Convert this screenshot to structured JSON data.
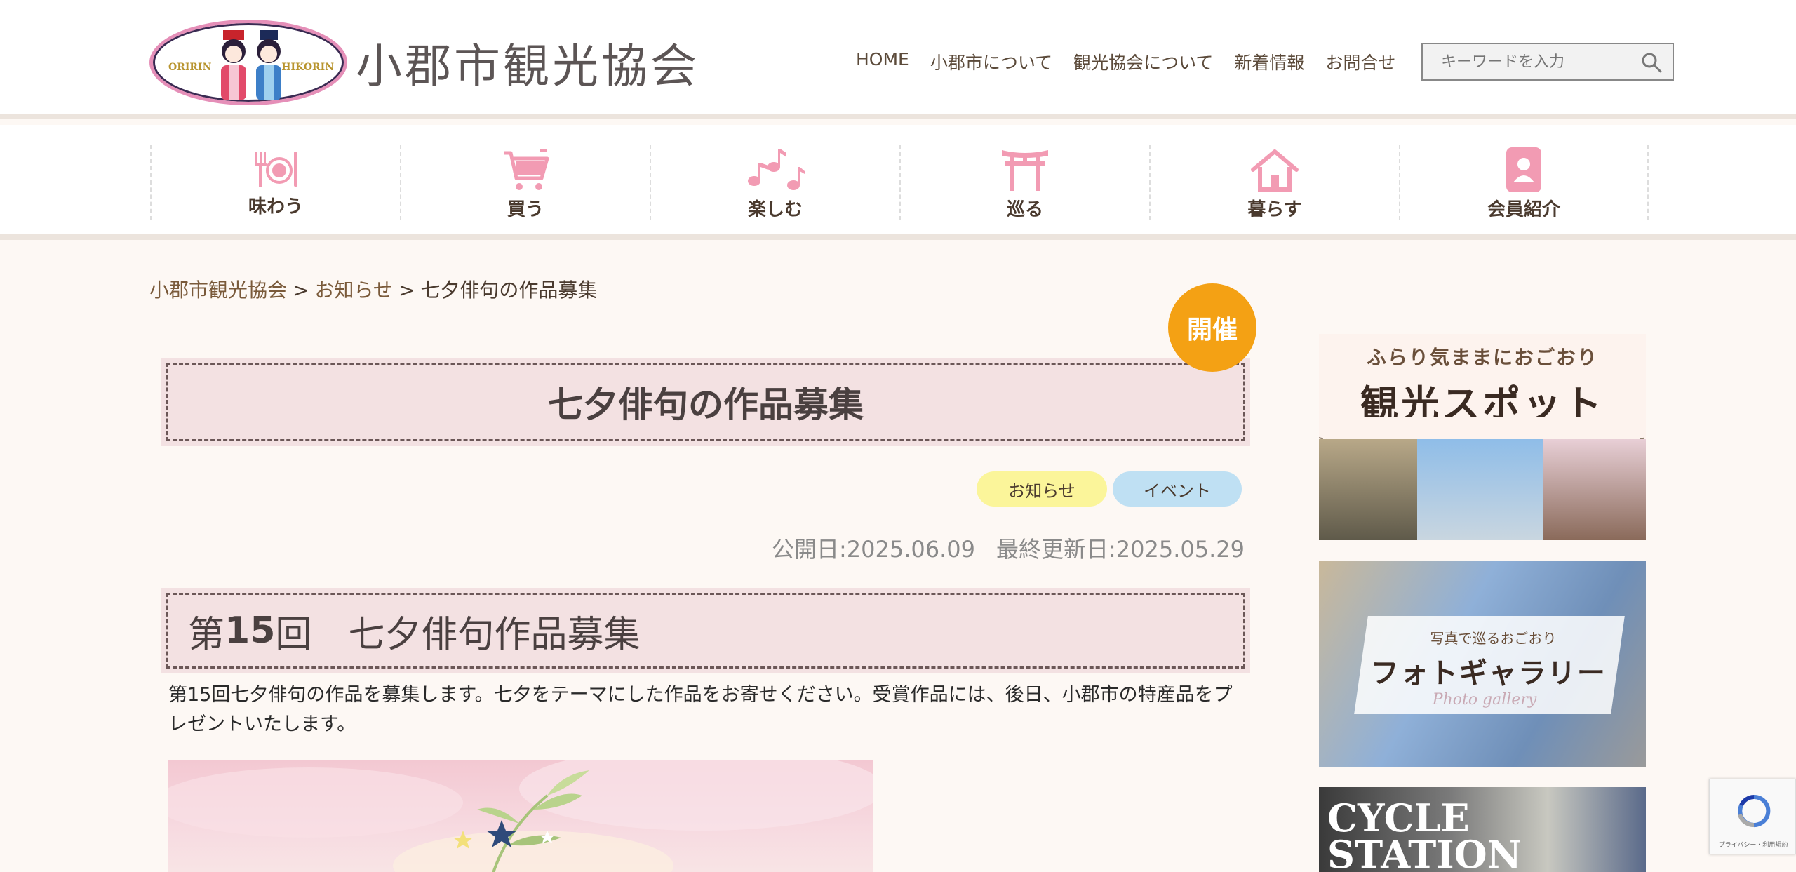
{
  "header": {
    "logo_text": "小郡市観光協会",
    "logo_left": "ORIRIN",
    "logo_right": "HIKORIN",
    "nav": [
      "HOME",
      "小郡市について",
      "観光協会について",
      "新着情報",
      "お問合せ"
    ],
    "search_placeholder": "キーワードを入力"
  },
  "categories": [
    {
      "label": "味わう",
      "icon": "dining-icon"
    },
    {
      "label": "買う",
      "icon": "cart-icon"
    },
    {
      "label": "楽しむ",
      "icon": "music-icon"
    },
    {
      "label": "巡る",
      "icon": "torii-icon"
    },
    {
      "label": "暮らす",
      "icon": "home-icon"
    },
    {
      "label": "会員紹介",
      "icon": "member-icon"
    }
  ],
  "breadcrumb": [
    "小郡市観光協会",
    "お知らせ",
    "七夕俳句の作品募集"
  ],
  "breadcrumb_sep": ">",
  "status_badge": "開催",
  "article": {
    "title": "七夕俳句の作品募集",
    "tags": [
      "お知らせ",
      "イベント"
    ],
    "published": "公開日:2025.06.09",
    "updated": "最終更新日:2025.05.29",
    "heading_prefix": "第",
    "heading_num": "15",
    "heading_rest": "回　七夕俳句作品募集",
    "body": "第15回七夕俳句の作品を募集します。七夕をテーマにした作品をお寄せください。受賞作品には、後日、小郡市の特産品をプレゼントいたします。"
  },
  "sidebar": {
    "banner1_top": "ふらり気ままにおごおり",
    "banner1_main": "観光スポット",
    "banner2_top": "写真で巡るおごおり",
    "banner2_main": "フォトギャラリー",
    "banner2_sub": "Photo gallery",
    "banner3_main": "CYCLE STATION"
  },
  "recaptcha_label": "プライバシー・利用規約",
  "colors": {
    "badge": "#f4a114",
    "title_bg": "#f3e1e2",
    "tag_yellow": "#fbf59a",
    "tag_blue": "#bfe0f3",
    "icon_pink": "#f29bb3"
  }
}
